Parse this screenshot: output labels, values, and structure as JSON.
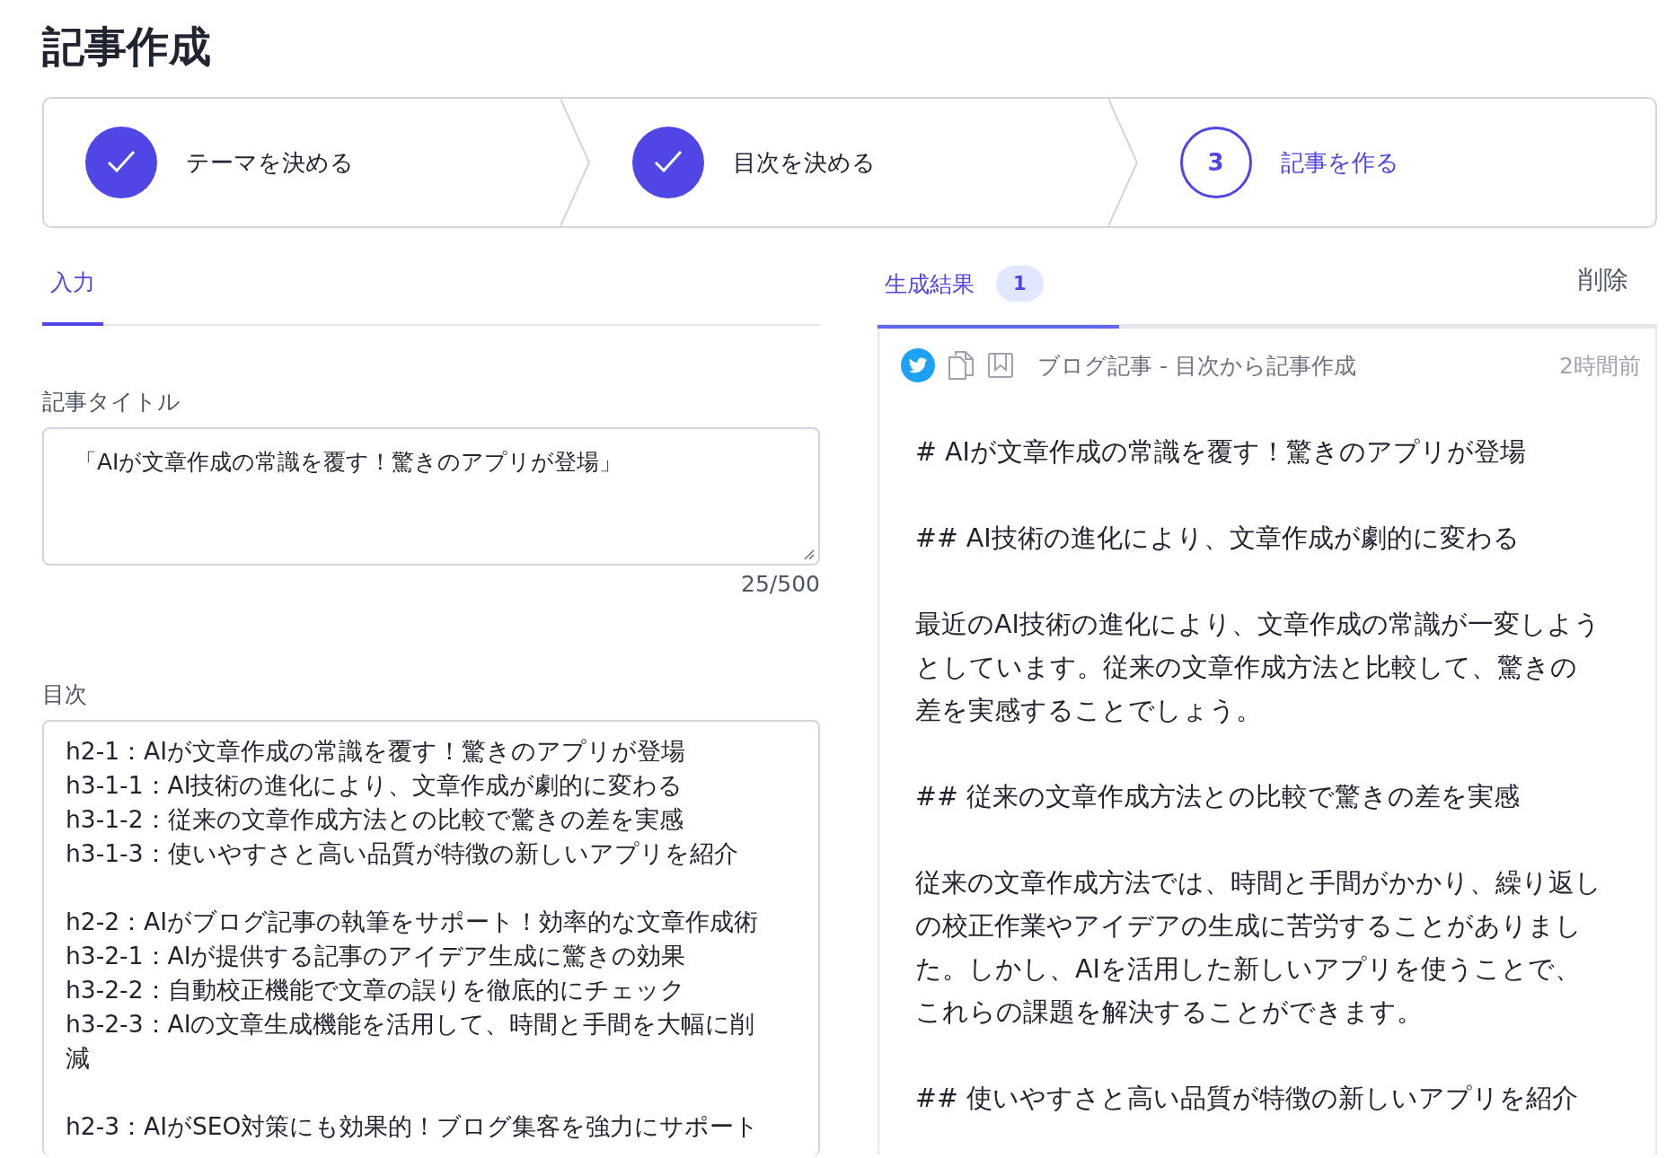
{
  "page_title": "記事作成",
  "steps": [
    {
      "label": "テーマを決める",
      "done": true,
      "selected": false
    },
    {
      "label": "目次を決める",
      "done": true,
      "selected": false
    },
    {
      "label": "記事を作る",
      "number": "3",
      "done": false,
      "selected": true
    }
  ],
  "input_panel": {
    "tab": {
      "label": "入力",
      "selected": true
    },
    "title_field": {
      "label": "記事タイトル",
      "value": "「AIが文章作成の常識を覆す！驚きのアプリが登場」",
      "counter": "25/500"
    },
    "outline_field": {
      "label": "目次",
      "value": "h2-1：AIが文章作成の常識を覆す！驚きのアプリが登場\nh3-1-1：AI技術の進化により、文章作成が劇的に変わる\nh3-1-2：従来の文章作成方法との比較で驚きの差を実感\nh3-1-3：使いやすさと高い品質が特徴の新しいアプリを紹介\n\nh2-2：AIがブログ記事の執筆をサポート！効率的な文章作成術\nh3-2-1：AIが提供する記事のアイデア生成に驚きの効果\nh3-2-2：自動校正機能で文章の誤りを徹底的にチェック\nh3-2-3：AIの文章生成機能を活用して、時間と手間を大幅に削減\n\nh2-3：AIがSEO対策にも効果的！ブログ集客を強力にサポート"
    }
  },
  "result_panel": {
    "tab": {
      "label": "生成結果",
      "badge": "1",
      "selected": true
    },
    "delete_button": "削除",
    "result": {
      "source": "ブログ記事 - 目次から記事作成",
      "time": "2時間前",
      "paragraphs": [
        "# AIが文章作成の常識を覆す！驚きのアプリが登場",
        "## AI技術の進化により、文章作成が劇的に変わる",
        "最近のAI技術の進化により、文章作成の常識が一変しようとしています。従来の文章作成方法と比較して、驚きの差を実感することでしょう。",
        "## 従来の文章作成方法との比較で驚きの差を実感",
        "従来の文章作成方法では、時間と手間がかかり、繰り返しの校正作業やアイデアの生成に苦労することがありました。しかし、AIを活用した新しいアプリを使うことで、これらの課題を解決することができます。",
        "## 使いやすさと高い品質が特徴の新しいアプリを紹介"
      ]
    }
  }
}
